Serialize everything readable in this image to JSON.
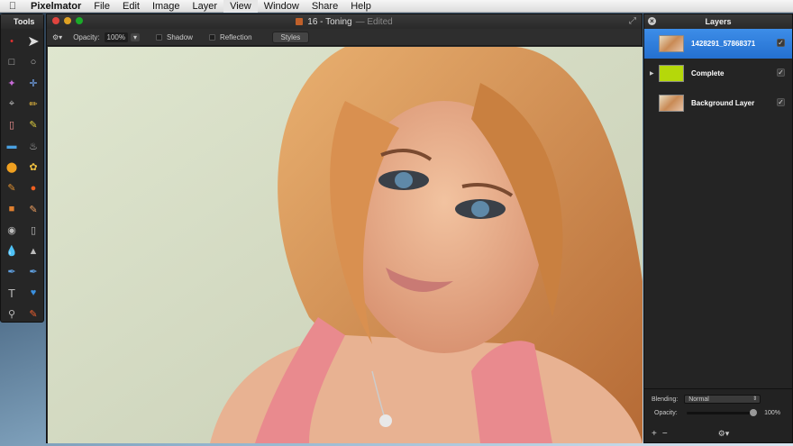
{
  "menubar": {
    "apple_icon": "apple-icon",
    "app_name": "Pixelmator",
    "items": [
      "File",
      "Edit",
      "Image",
      "Layer",
      "View",
      "Window",
      "Share",
      "Help"
    ],
    "active_item": "View"
  },
  "tools_panel": {
    "title": "Tools",
    "icons": [
      "red-pixel-icon",
      "pointer-arrow-icon",
      "rect-select-icon",
      "ellipse-select-icon",
      "magic-wand-icon",
      "lasso-icon",
      "crop-icon",
      "eyedropper-icon",
      "eraser-icon",
      "pencil-icon",
      "gradient-icon",
      "paint-bucket-icon",
      "sponge-icon",
      "burn-icon",
      "brush-icon",
      "dodge-icon",
      "clone-stamp-icon",
      "smudge-icon",
      "red-eye-icon",
      "eraser-alt-icon",
      "blur-icon",
      "sharpen-icon",
      "pen-icon",
      "freeform-pen-icon",
      "type-icon",
      "shape-heart-icon",
      "zoom-icon",
      "hand-icon"
    ]
  },
  "document": {
    "title": "16 - Toning",
    "status": "— Edited"
  },
  "toolbar": {
    "opacity_label": "Opacity:",
    "opacity_value": "100%",
    "shadow_label": "Shadow",
    "reflection_label": "Reflection",
    "styles_label": "Styles"
  },
  "layers_panel": {
    "title": "Layers",
    "layers": [
      {
        "name": "1428291_57868371",
        "selected": true,
        "visible": true
      },
      {
        "name": "Complete",
        "selected": false,
        "visible": true
      },
      {
        "name": "Background Layer",
        "selected": false,
        "visible": true
      }
    ],
    "blending_label": "Blending:",
    "blending_value": "Normal",
    "opacity_label": "Opacity:",
    "opacity_value": "100%"
  },
  "colors": {
    "selection_blue": "#2f7fe0",
    "group_thumb": "#b5d80a",
    "panel_bg": "#242424"
  }
}
